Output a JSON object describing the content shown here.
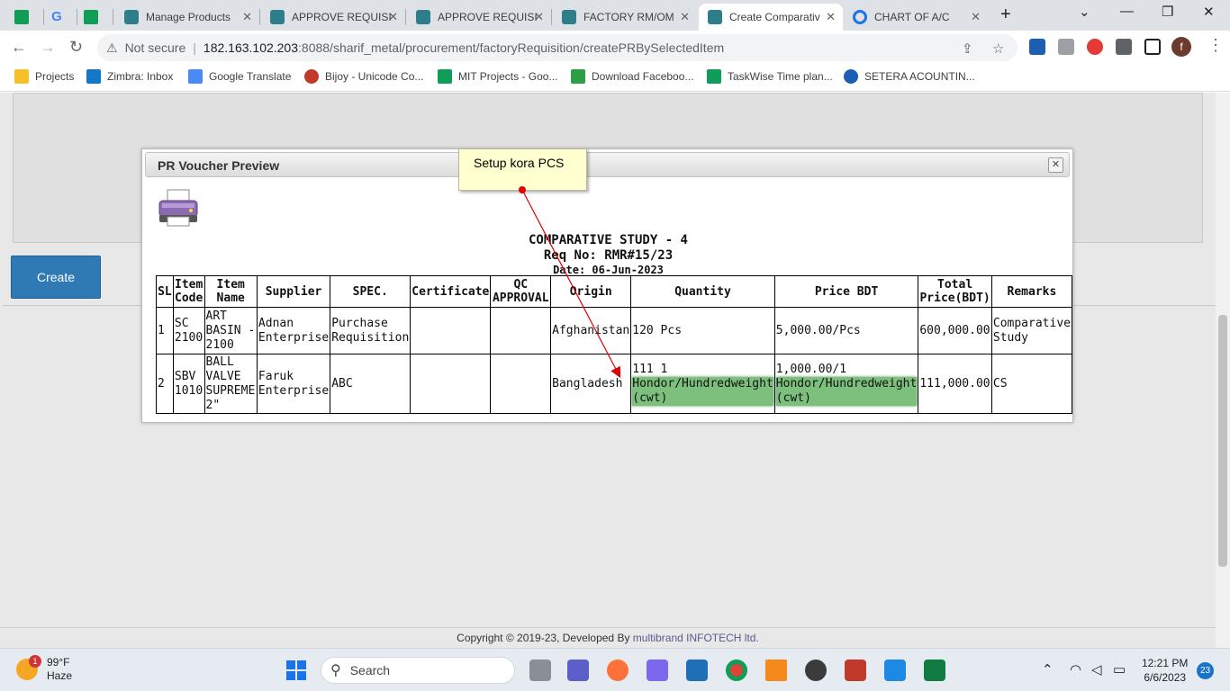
{
  "browser": {
    "tabs": [
      {
        "label": "",
        "icon": "sheets-icon"
      },
      {
        "label": "",
        "icon": "google-icon"
      },
      {
        "label": "",
        "icon": "sheets-icon"
      },
      {
        "label": "Manage Products",
        "icon": "erp-icon"
      },
      {
        "label": "APPROVE REQUISI",
        "icon": "erp-icon"
      },
      {
        "label": "APPROVE REQUISI",
        "icon": "erp-icon"
      },
      {
        "label": "FACTORY RM/OM",
        "icon": "erp-icon"
      },
      {
        "label": "Create Comparativ",
        "icon": "erp-icon"
      },
      {
        "label": "CHART OF A/C",
        "icon": "gear-icon"
      }
    ],
    "new_tab": "+",
    "not_secure": "Not secure",
    "url_host": "182.163.102.203",
    "url_path": ":8088/sharif_metal/procurement/factoryRequisition/createPRBySelectedItem",
    "profile_initial": "f",
    "bookmarks": [
      {
        "label": "Projects",
        "color": "#f6c026"
      },
      {
        "label": "Zimbra: Inbox",
        "color": "#1478c8"
      },
      {
        "label": "Google Translate",
        "color": "#4a8af4"
      },
      {
        "label": "Bijoy - Unicode Co...",
        "color": "#c0392b"
      },
      {
        "label": "MIT Projects - Goo...",
        "color": "#0f9d58"
      },
      {
        "label": "Download Faceboo...",
        "color": "#2e9e47"
      },
      {
        "label": "TaskWise Time plan...",
        "color": "#0f9d58"
      },
      {
        "label": "SETERA ACOUNTIN...",
        "color": "#1a5fb4"
      }
    ]
  },
  "page": {
    "create_button": "Create",
    "footer_prefix": "Copyright © 2019-23, Developed By ",
    "footer_dev": "multibrand INFOTECH ltd."
  },
  "modal": {
    "title": "PR Voucher Preview",
    "close": "✕",
    "doc_title": "COMPARATIVE STUDY - 4",
    "req_no": "Req No: RMR#15/23",
    "date": "Date: 06-Jun-2023",
    "columns": [
      "SL",
      "Item Code",
      "Item Name",
      "Supplier",
      "SPEC.",
      "Certificate",
      "QC APPROVAL",
      "Origin",
      "Quantity",
      "Price BDT",
      "Total Price(BDT)",
      "Remarks"
    ],
    "rows": [
      {
        "sl": "1",
        "code": "SC 2100",
        "name": "ART BASIN - 2100",
        "supplier": "Adnan Enterprise",
        "spec": "Purchase Requisition",
        "certificate": "",
        "qc": "",
        "origin": "Afghanistan",
        "qty": "120 Pcs",
        "qty_line1": "",
        "price": "5,000.00/Pcs",
        "price_line1": "",
        "total": "600,000.00",
        "remarks": "Comparative Study"
      },
      {
        "sl": "2",
        "code": "SBV 1010",
        "name": "BALL VALVE SUPREME 2\"",
        "supplier": "Faruk Enterprise",
        "spec": "ABC",
        "certificate": "",
        "qc": "",
        "origin": "Bangladesh",
        "qty_line1": "111 1",
        "qty": "Hondor/Hundredweight (cwt)",
        "price_line1": "1,000.00/1",
        "price": "Hondor/Hundredweight (cwt)",
        "total": "111,000.00",
        "remarks": "CS"
      }
    ]
  },
  "annotation": {
    "callout": "Setup kora PCS",
    "color": "#e00000"
  },
  "taskbar": {
    "temp": "99°F",
    "weather": "Haze",
    "weather_badge": "1",
    "search": "Search",
    "time": "12:21 PM",
    "date": "6/6/2023",
    "notifications": "23"
  }
}
